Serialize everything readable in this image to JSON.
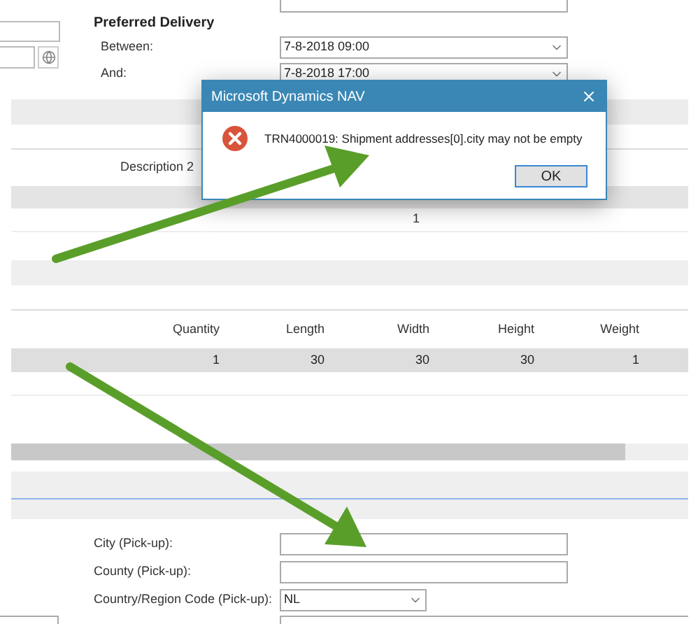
{
  "delivery": {
    "heading": "Preferred Delivery",
    "fields": [
      {
        "label": "Between:",
        "value": "7-8-2018 09:00"
      },
      {
        "label": "And:",
        "value": "7-8-2018 17:00"
      }
    ]
  },
  "description_label": "Description 2",
  "line_value": "1",
  "table": {
    "columns": [
      "Quantity",
      "Length",
      "Width",
      "Height",
      "Weight"
    ],
    "rows": [
      [
        "1",
        "30",
        "30",
        "30",
        "1"
      ]
    ]
  },
  "pickup": {
    "fields": [
      {
        "kind": "text",
        "label": "City (Pick-up):"
      },
      {
        "kind": "text",
        "label": "County (Pick-up):"
      },
      {
        "kind": "select",
        "label": "Country/Region Code (Pick-up):",
        "value": "NL"
      }
    ]
  },
  "dialog": {
    "title": "Microsoft Dynamics NAV",
    "message": "TRN4000019: Shipment addresses[0].city may not be empty",
    "buttons": [
      "OK"
    ]
  }
}
